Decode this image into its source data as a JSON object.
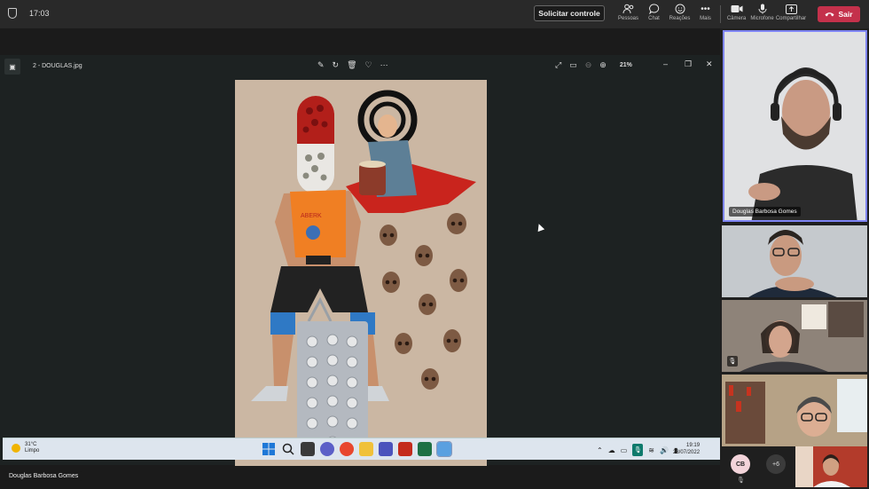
{
  "topbar": {
    "time": "17:03",
    "request_control": "Solicitar controle",
    "items": [
      {
        "label": "Pessoas",
        "icon": "people-icon"
      },
      {
        "label": "Chat",
        "icon": "chat-icon"
      },
      {
        "label": "Reações",
        "icon": "reactions-icon"
      },
      {
        "label": "Mais",
        "icon": "more-icon"
      }
    ],
    "controls": [
      {
        "label": "Câmera",
        "icon": "camera-icon"
      },
      {
        "label": "Microfone",
        "icon": "microphone-icon"
      },
      {
        "label": "Compartilhar",
        "icon": "share-icon"
      }
    ],
    "leave": "Sair"
  },
  "photos": {
    "title": "2 - DOUGLAS.jpg",
    "zoom": "21%"
  },
  "taskbar": {
    "temp": "31°C",
    "condition": "Limpo",
    "time": "19:19",
    "date": "28/07/2022"
  },
  "presenter": "Douglas Barbosa Gomes",
  "participants": {
    "main_name": "Douglas Barbosa Gomes",
    "avatar_initials": "CB",
    "more_count": "+6"
  },
  "colors": {
    "leave": "#c4314b",
    "accent": "#6264a7"
  }
}
